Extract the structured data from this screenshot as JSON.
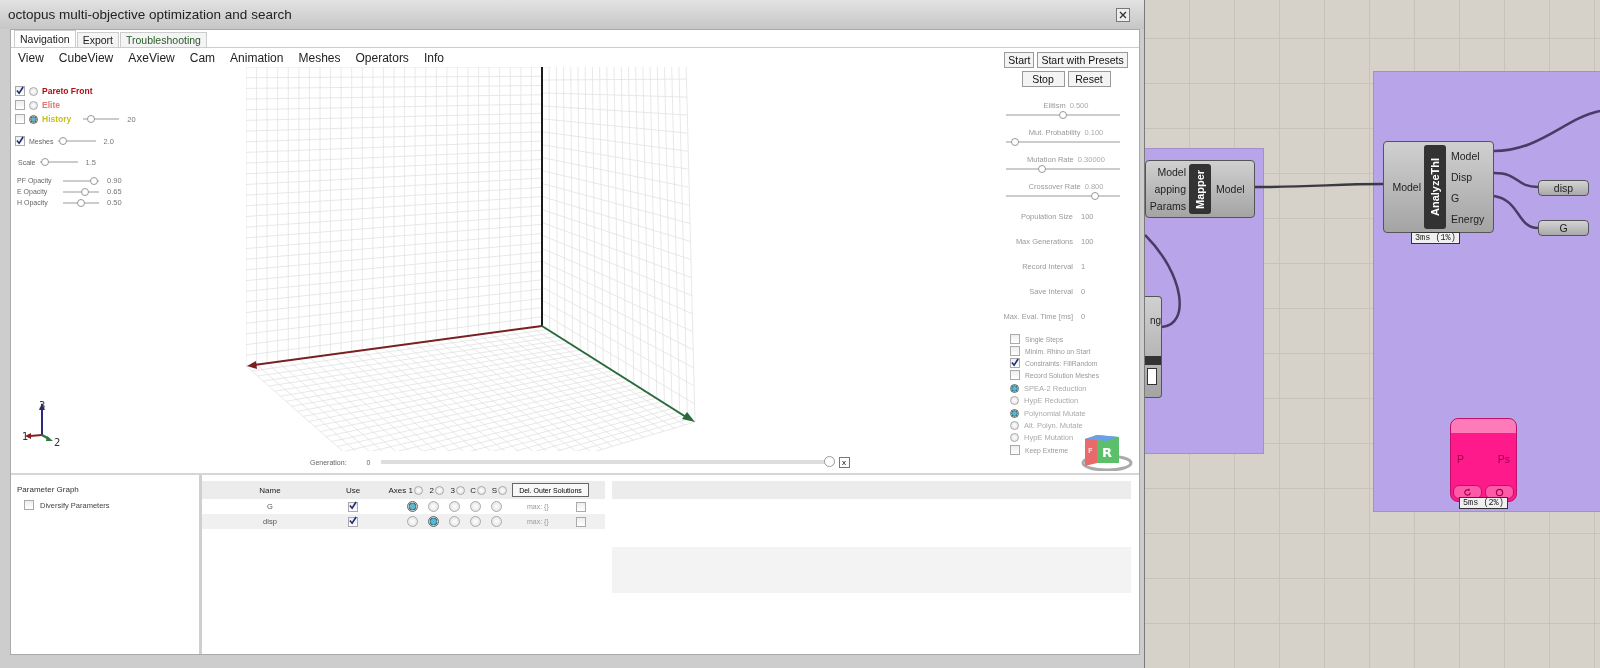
{
  "window": {
    "title": "octopus multi-objective optimization and search"
  },
  "tabs": [
    {
      "label": "Navigation",
      "selected": true
    },
    {
      "label": "Export",
      "selected": false
    },
    {
      "label": "Troubleshooting",
      "selected": false
    }
  ],
  "menu": [
    "View",
    "CubeView",
    "AxeView",
    "Cam",
    "Animation",
    "Meshes",
    "Operators",
    "Info"
  ],
  "layers": [
    {
      "label": "Pareto Front",
      "checked": true,
      "selected": false,
      "color": "#b0101a"
    },
    {
      "label": "Elite",
      "checked": false,
      "selected": false,
      "color": "#e07878"
    },
    {
      "label": "History",
      "checked": false,
      "selected": true,
      "color": "#c8c020",
      "level": 0.15,
      "reading": "20"
    }
  ],
  "meshes": {
    "label": "Meshes",
    "checked": true,
    "level": 0.05,
    "reading": "2.0"
  },
  "scale": {
    "label": "Scale",
    "level": 0.05,
    "reading": "1.5"
  },
  "opacities": [
    {
      "label": "PF Opacity",
      "level": 0.95,
      "reading": "0.90"
    },
    {
      "label": "E Opacity",
      "level": 0.65,
      "reading": "0.65"
    },
    {
      "label": "H Opacity",
      "level": 0.5,
      "reading": "0.50"
    }
  ],
  "axis_gizmo": [
    "1",
    "2",
    "3"
  ],
  "generation": {
    "label": "Generation:",
    "value": "0",
    "level": 1,
    "close": "x"
  },
  "view_cube": [
    "F",
    "R"
  ],
  "button_rows": [
    {
      "buttons": [
        "Start",
        "Start with Presets"
      ]
    },
    {
      "buttons": [
        "Stop",
        "Reset"
      ]
    }
  ],
  "operator_sliders": [
    {
      "label": "Elitism",
      "reading": "0.500",
      "level": 0.5
    },
    {
      "label": "Mut. Probability",
      "reading": "0.100",
      "level": 0.05
    },
    {
      "label": "Mutation Rate",
      "reading": "0.30000",
      "level": 0.3
    },
    {
      "label": "Crossover Rate",
      "reading": "0.800",
      "level": 0.8
    }
  ],
  "settings": [
    {
      "label": "Population Size",
      "value": "100"
    },
    {
      "label": "Max Generations",
      "value": "100"
    },
    {
      "label": "Record Interval",
      "value": "1"
    },
    {
      "label": "Save Interval",
      "value": "0"
    },
    {
      "label": "Max. Eval. Time [ms]",
      "value": "0"
    }
  ],
  "options": [
    {
      "kind": "check",
      "label": "Single Steps",
      "checked": false
    },
    {
      "kind": "check",
      "label": "Minim. Rhino on Start",
      "checked": false
    },
    {
      "kind": "check",
      "label": "Constraints: FillRandom",
      "checked": true
    },
    {
      "kind": "check",
      "label": "Record Solution Meshes",
      "checked": false
    },
    {
      "kind": "radio",
      "label": "SPEA-2 Reduction",
      "selected": true
    },
    {
      "kind": "radio",
      "label": "HypE Reduction",
      "selected": false
    },
    {
      "kind": "radio",
      "label": "Polynomial Mutate",
      "selected": true
    },
    {
      "kind": "radio",
      "label": "Alt. Polyn. Mutate",
      "selected": false
    },
    {
      "kind": "radio",
      "label": "HypE Mutation",
      "selected": false
    },
    {
      "kind": "check",
      "label": "Keep Extreme",
      "checked": false
    }
  ],
  "parameter_graph": {
    "title": "Parameter Graph",
    "diversify": {
      "label": "Diversify Parameters",
      "checked": false
    }
  },
  "objectives": {
    "columns": [
      "Name",
      "Use"
    ],
    "axes": [
      {
        "label": "Axes 1",
        "selected": false
      },
      {
        "label": "2",
        "selected": false
      },
      {
        "label": "3",
        "selected": false
      },
      {
        "label": "C",
        "selected": false
      },
      {
        "label": "S",
        "selected": false
      }
    ],
    "delete_button": "Del. Outer Solutions",
    "rows": [
      {
        "name": "G",
        "use": true,
        "axes": [
          {
            "selected": true
          },
          {
            "selected": false
          },
          {
            "selected": false
          },
          {
            "selected": false
          },
          {
            "selected": false
          }
        ],
        "max": "max: {}",
        "checked": false
      },
      {
        "name": "disp",
        "use": true,
        "axes": [
          {
            "selected": false
          },
          {
            "selected": true
          },
          {
            "selected": false
          },
          {
            "selected": false
          },
          {
            "selected": false
          }
        ],
        "max": "max: {}",
        "checked": false
      }
    ]
  },
  "canvas": {
    "nodes": [
      {
        "kind": "component",
        "title": "Mapper",
        "inputs": [
          "Model",
          "apping",
          "Params"
        ],
        "outputs": [
          "Model"
        ]
      },
      {
        "kind": "partial",
        "outputs": [
          "ng"
        ]
      },
      {
        "kind": "component",
        "title": "AnalyzeThI",
        "inputs": [
          "Model"
        ],
        "outputs": [
          "Model",
          "Disp",
          "G",
          "Energy"
        ],
        "timing": "3ms (1%)"
      },
      {
        "kind": "param",
        "label": "disp"
      },
      {
        "kind": "param",
        "label": "G"
      },
      {
        "kind": "pink",
        "inputs": [
          "P"
        ],
        "outputs": [
          "Ps"
        ],
        "timing": "5ms (2%)"
      }
    ]
  }
}
